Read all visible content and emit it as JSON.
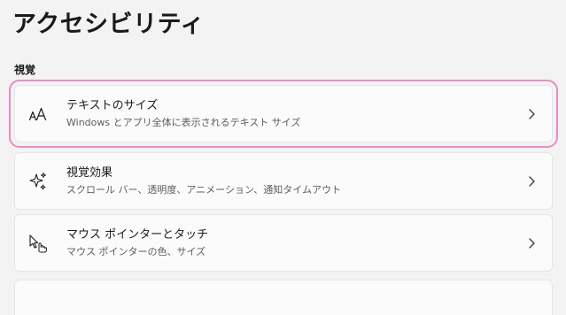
{
  "page": {
    "title": "アクセシビリティ"
  },
  "section": {
    "header": "視覚"
  },
  "items": [
    {
      "title": "テキストのサイズ",
      "description": "Windows とアプリ全体に表示されるテキスト サイズ",
      "icon": "text-size-icon",
      "focused": true
    },
    {
      "title": "視覚効果",
      "description": "スクロール バー、透明度、アニメーション、通知タイムアウト",
      "icon": "sparkle-icon",
      "focused": false
    },
    {
      "title": "マウス ポインターとタッチ",
      "description": "マウス ポインターの色、サイズ",
      "icon": "pointer-touch-icon",
      "focused": false
    }
  ],
  "colors": {
    "background": "#f3f3f3",
    "card": "#fbfbfb",
    "focus_outline": "#ea8cc0",
    "description_text": "#5d5d5d"
  }
}
